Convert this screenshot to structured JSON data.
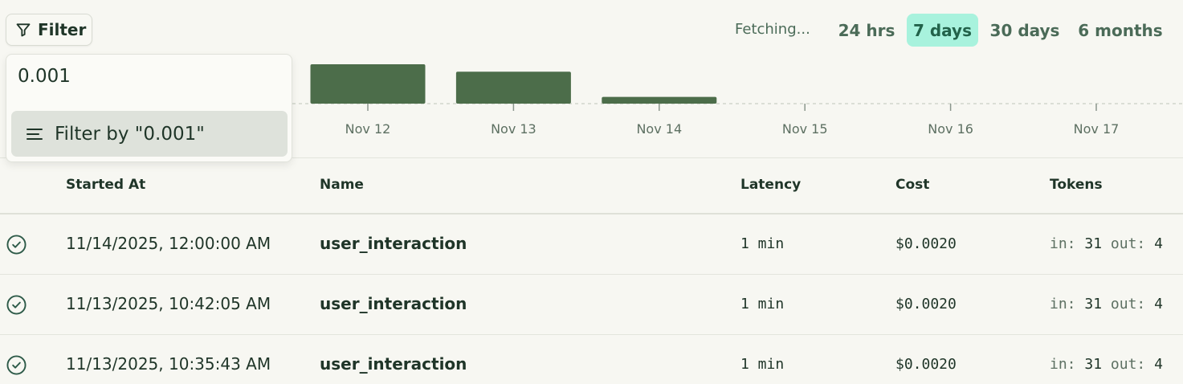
{
  "toolbar": {
    "filter_label": "Filter",
    "fetching_text": "Fetching...",
    "ranges": [
      {
        "label": "24 hrs",
        "active": false
      },
      {
        "label": "7 days",
        "active": true
      },
      {
        "label": "30 days",
        "active": false
      },
      {
        "label": "6 months",
        "active": false
      }
    ]
  },
  "filter_dropdown": {
    "input_value": "0.001",
    "option_label": "Filter by \"0.001\""
  },
  "chart_data": {
    "type": "bar",
    "categories": [
      "Nov 12",
      "Nov 13",
      "Nov 14",
      "Nov 15",
      "Nov 16",
      "Nov 17"
    ],
    "values": [
      1.0,
      0.81,
      0.17,
      0,
      0,
      0
    ],
    "bar_color": "#4c6d4a"
  },
  "table": {
    "columns": [
      "Started At",
      "Name",
      "Latency",
      "Cost",
      "Tokens"
    ],
    "rows": [
      {
        "status": "success",
        "started_at": "11/14/2025, 12:00:00 AM",
        "name": "user_interaction",
        "latency": "1 min",
        "cost": "$0.0020",
        "tokens_in_label": "in:",
        "tokens_in": "31",
        "tokens_out_label": "out:",
        "tokens_out": "4"
      },
      {
        "status": "success",
        "started_at": "11/13/2025, 10:42:05 AM",
        "name": "user_interaction",
        "latency": "1 min",
        "cost": "$0.0020",
        "tokens_in_label": "in:",
        "tokens_in": "31",
        "tokens_out_label": "out:",
        "tokens_out": "4"
      },
      {
        "status": "success",
        "started_at": "11/13/2025, 10:35:43 AM",
        "name": "user_interaction",
        "latency": "1 min",
        "cost": "$0.0020",
        "tokens_in_label": "in:",
        "tokens_in": "31",
        "tokens_out_label": "out:",
        "tokens_out": "4"
      }
    ]
  },
  "colors": {
    "accent": "#a8f2dd",
    "bar": "#4c6d4a",
    "text": "#1f3528"
  }
}
